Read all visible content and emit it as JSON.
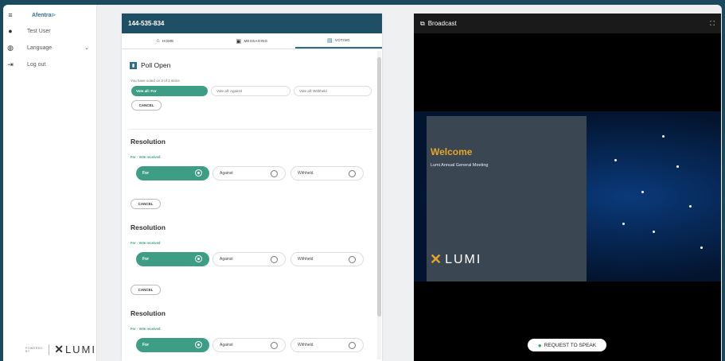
{
  "sidebar": {
    "brand": "Afentra",
    "items": [
      {
        "icon": "hamburger-icon",
        "glyph": "≡",
        "label": ""
      },
      {
        "icon": "user-icon",
        "glyph": "●",
        "label": "Test User"
      },
      {
        "icon": "globe-icon",
        "glyph": "◍",
        "label": "Language"
      },
      {
        "icon": "logout-icon",
        "glyph": "⇥",
        "label": "Log out"
      }
    ],
    "footer": {
      "powered": "POWERED BY",
      "logo": "LUMI"
    }
  },
  "voting": {
    "meeting_id": "144-535-834",
    "tabs": [
      {
        "label": "HOME",
        "icon": "home-icon",
        "glyph": "⌂"
      },
      {
        "label": "MESSAGING",
        "icon": "messaging-icon",
        "glyph": "▣"
      },
      {
        "label": "VOTING",
        "icon": "voting-icon",
        "glyph": "▤"
      }
    ],
    "poll_title": "Poll Open",
    "voted_text": "You have voted on 3 of 3 items",
    "vote_all": {
      "for": "Vote all: For",
      "against": "Vote all: Against",
      "withheld": "Vote all: Withheld"
    },
    "cancel": "CANCEL",
    "resolutions": [
      {
        "title": "Resolution",
        "status": "For - Vote received",
        "for": "For",
        "against": "Against",
        "withheld": "Withheld",
        "cancel": "CANCEL"
      },
      {
        "title": "Resolution",
        "status": "For - Vote received",
        "for": "For",
        "against": "Against",
        "withheld": "Withheld",
        "cancel": "CANCEL"
      },
      {
        "title": "Resolution",
        "status": "For - Vote received",
        "for": "For",
        "against": "Against",
        "withheld": "Withheld"
      }
    ]
  },
  "broadcast": {
    "title": "Broadcast",
    "slide_title": "Welcome",
    "slide_subtitle": "Lumi Annual General Meeting",
    "slide_logo": "LUMI",
    "request_to_speak": "REQUEST TO SPEAK"
  },
  "colors": {
    "accent": "#3e9e85",
    "header": "#1f4f64",
    "frame": "#1b4a5e",
    "slide_title": "#e6a52b"
  }
}
